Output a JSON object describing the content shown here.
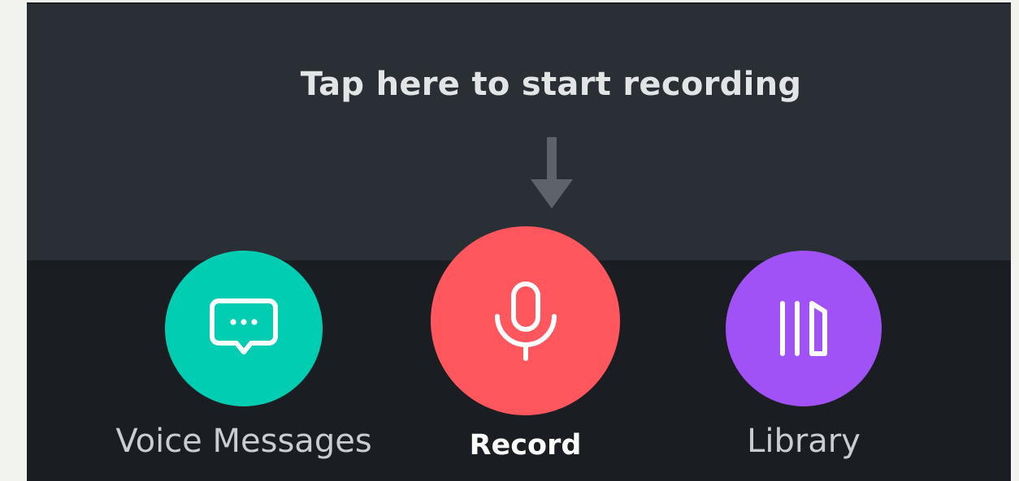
{
  "hint": {
    "text": "Tap here to start recording",
    "arrow_icon": "arrow-down-icon"
  },
  "actions": {
    "voice_messages": {
      "label": "Voice Messages",
      "icon": "chat-bubble-icon",
      "color": "#00cdb1"
    },
    "record": {
      "label": "Record",
      "icon": "microphone-icon",
      "color": "#ff575d"
    },
    "library": {
      "label": "Library",
      "icon": "library-icon",
      "color": "#a052f6"
    }
  },
  "colors": {
    "hint_panel": "#2a2f36",
    "bottom_bar": "#1a1d21",
    "page_background": "#f2f2ee",
    "arrow": "#5d636b"
  }
}
